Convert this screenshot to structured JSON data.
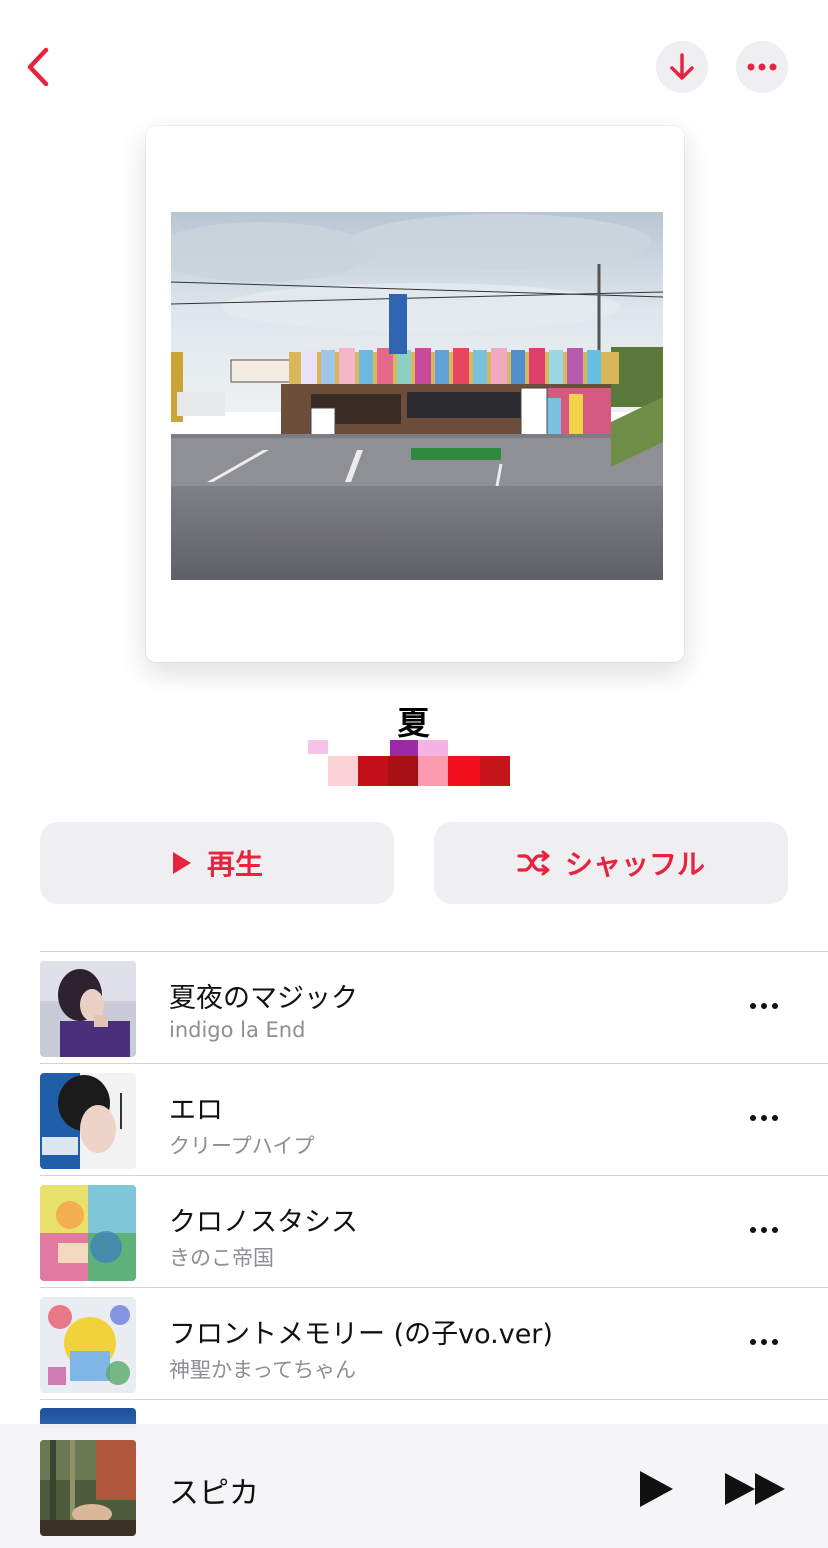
{
  "nav": {
    "back_icon": "chevron-left-icon",
    "download_icon": "arrow-down-icon",
    "more_icon": "ellipsis-icon"
  },
  "album": {
    "title": "夏"
  },
  "actions": {
    "play_label": "再生",
    "shuffle_label": "シャッフル"
  },
  "tracks": [
    {
      "title": "夏夜のマジック",
      "artist": "indigo la End"
    },
    {
      "title": "エロ",
      "artist": "クリープハイプ"
    },
    {
      "title": "クロノスタシス",
      "artist": "きのこ帝国"
    },
    {
      "title": "フロントメモリー (の子vo.ver)",
      "artist": "神聖かまってちゃん"
    }
  ],
  "now_playing": {
    "title": "スピカ"
  },
  "colors": {
    "accent": "#e8233f",
    "button_bg": "#efeff1",
    "secondary_text": "#8e8e93"
  }
}
